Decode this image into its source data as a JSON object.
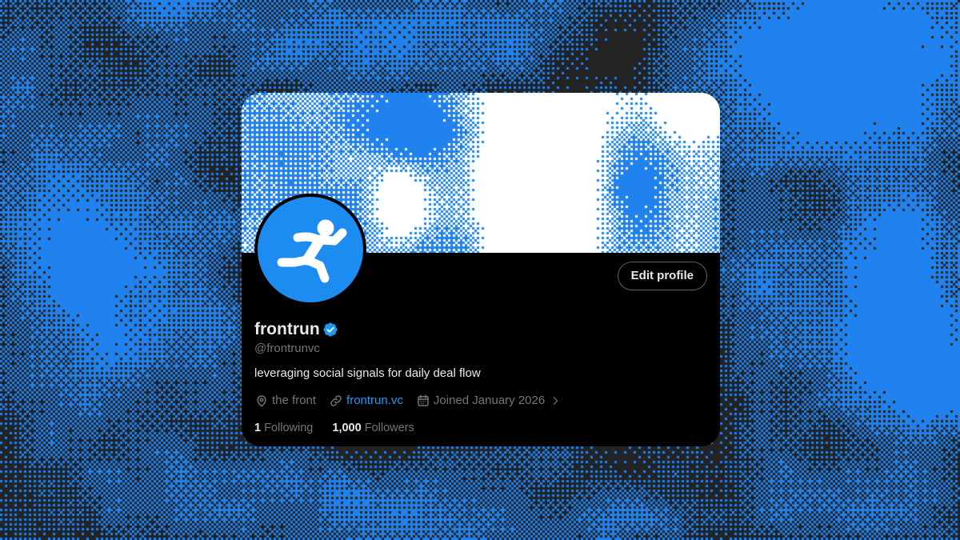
{
  "profile": {
    "display_name": "frontrun",
    "handle": "@frontrunvc",
    "bio": "leveraging social signals for daily deal flow",
    "location": "the front",
    "website": "frontrun.vc",
    "joined": "Joined January 2026",
    "following_count": "1",
    "following_label": "Following",
    "followers_count": "1,000",
    "followers_label": "Followers"
  },
  "actions": {
    "edit_profile_label": "Edit profile"
  },
  "icons": {
    "avatar": "runner-icon",
    "verified": "verified-badge-icon",
    "location": "location-pin-icon",
    "website": "link-icon",
    "joined": "calendar-icon",
    "joined_more": "chevron-right-icon"
  },
  "colors": {
    "page_background": "#232323",
    "halftone_blue": "#1f82ee",
    "card_background": "#000000",
    "banner_light": "#ffffff",
    "avatar_fill": "#1d8cf0",
    "accent": "#1d9bf0",
    "text_primary": "#e7e9ea",
    "text_secondary": "#71767b",
    "button_border": "#536471"
  }
}
